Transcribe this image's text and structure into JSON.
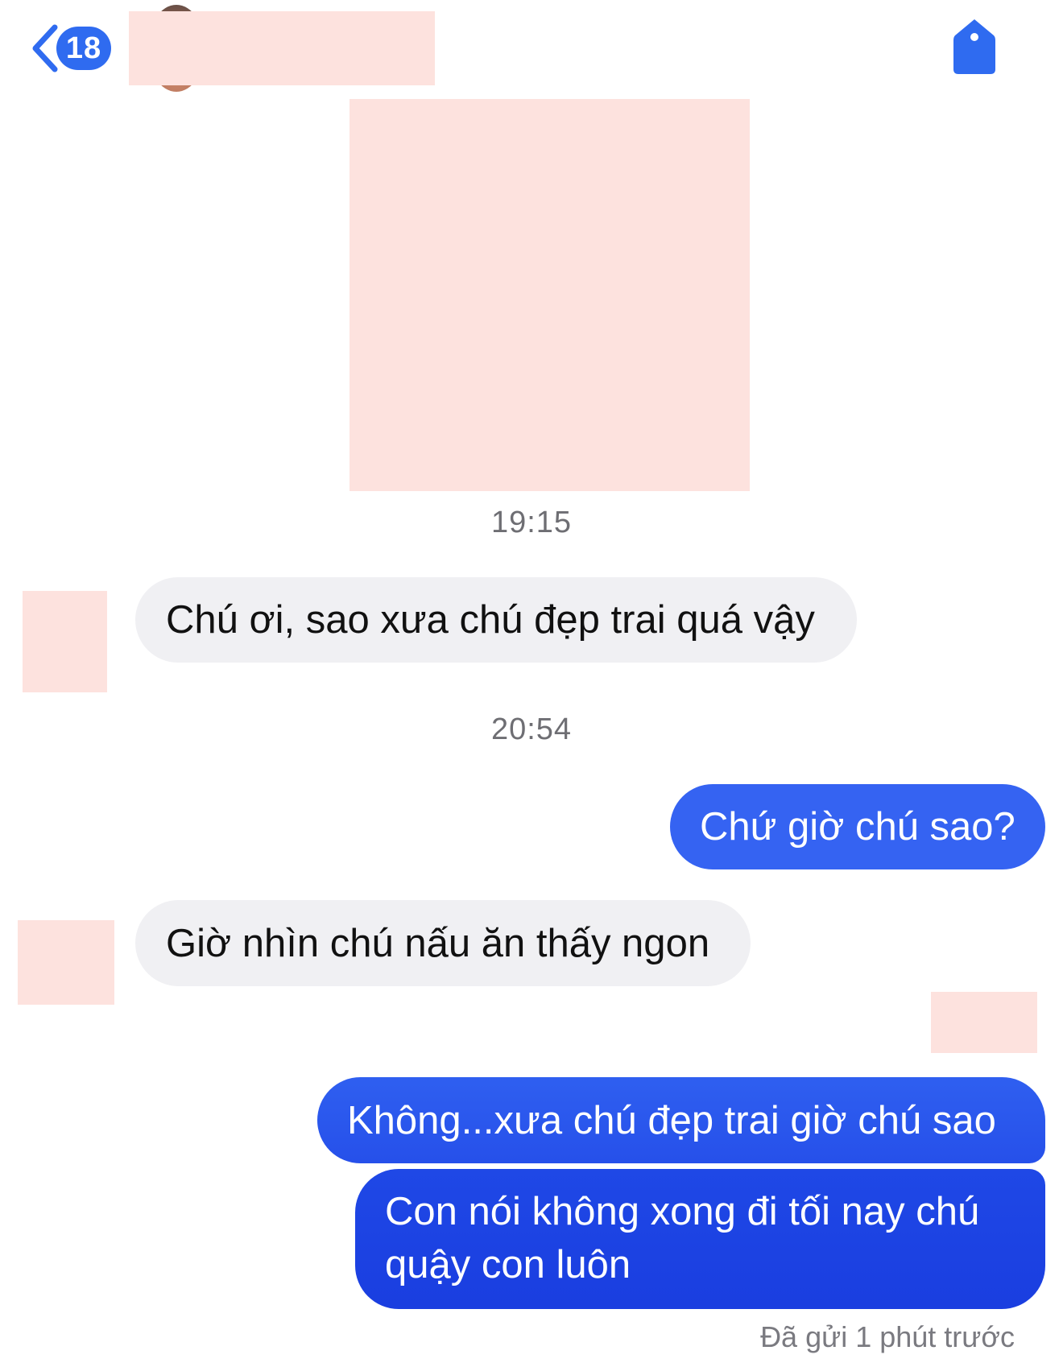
{
  "header": {
    "unread_count": "18",
    "back_icon": "chevron-left-icon",
    "tag_icon": "tag-icon",
    "accent_color": "#2f6bf0"
  },
  "messages": [
    {
      "type": "timestamp",
      "text": "19:15"
    },
    {
      "type": "incoming",
      "text": "Chú ơi, sao xưa chú đẹp trai quá vậy"
    },
    {
      "type": "timestamp",
      "text": "20:54"
    },
    {
      "type": "outgoing",
      "text": "Chứ giờ chú sao?"
    },
    {
      "type": "incoming",
      "text": "Giờ nhìn chú nấu ăn thấy ngon"
    },
    {
      "type": "outgoing",
      "text": "Không...xưa chú đẹp trai giờ chú sao"
    },
    {
      "type": "outgoing",
      "lines": [
        "Con nói không xong đi tối nay chú",
        "quậy con luôn"
      ]
    }
  ],
  "status": "Đã gửi 1 phút trước",
  "colors": {
    "incoming_bubble": "#f0f0f3",
    "outgoing_top": "#3563f2",
    "outgoing_bottom": "#1a3ee0",
    "redaction": "#fde2de"
  }
}
